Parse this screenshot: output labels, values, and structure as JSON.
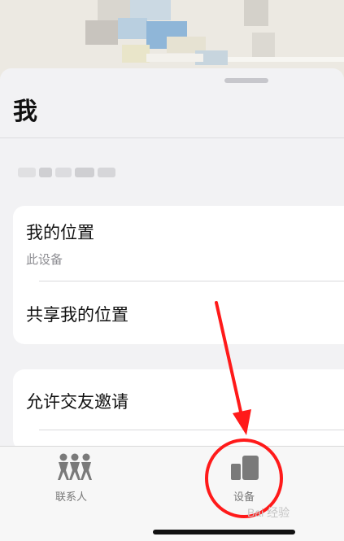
{
  "sheet": {
    "title": "我"
  },
  "card_location": {
    "my_location_title": "我的位置",
    "my_location_subtitle": "此设备",
    "share_location_title": "共享我的位置"
  },
  "card_friends": {
    "allow_friend_requests_title": "允许交友邀请"
  },
  "tabbar": {
    "tabs": [
      {
        "label": "联系人"
      },
      {
        "label": "设备"
      }
    ]
  },
  "watermark": {
    "text": "Bai 经验"
  },
  "annotation": {
    "color": "#ff1a1a"
  }
}
